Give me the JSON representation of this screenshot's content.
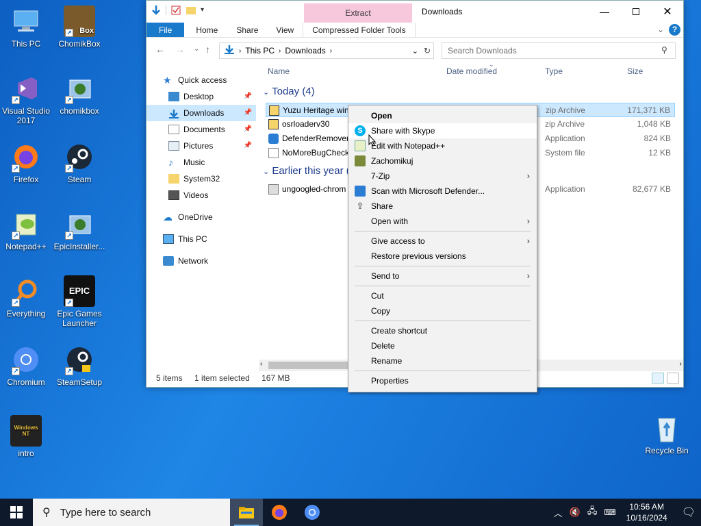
{
  "desktop": {
    "icons": [
      {
        "label": "This PC",
        "icon": "this-pc-icon"
      },
      {
        "label": "ChomikBox",
        "icon": "chomikbox-icon"
      },
      {
        "label": "Visual Studio 2017",
        "icon": "visual-studio-icon"
      },
      {
        "label": "chomikbox",
        "icon": "installer-icon"
      },
      {
        "label": "Firefox",
        "icon": "firefox-icon"
      },
      {
        "label": "Steam",
        "icon": "steam-icon"
      },
      {
        "label": "Notepad++",
        "icon": "notepadpp-icon"
      },
      {
        "label": "EpicInstaller...",
        "icon": "installer-icon"
      },
      {
        "label": "Everything",
        "icon": "everything-icon"
      },
      {
        "label": "Epic Games Launcher",
        "icon": "epic-games-icon"
      },
      {
        "label": "Chromium",
        "icon": "chromium-icon"
      },
      {
        "label": "SteamSetup",
        "icon": "steam-setup-icon"
      },
      {
        "label": "intro",
        "icon": "video-icon"
      },
      {
        "label": "Recycle Bin",
        "icon": "recycle-bin-icon"
      }
    ]
  },
  "explorer": {
    "title": "Downloads",
    "context_tab_header": "Extract",
    "ribbon_tabs": [
      "File",
      "Home",
      "Share",
      "View",
      "Compressed Folder Tools"
    ],
    "address": {
      "parts": [
        "This PC",
        "Downloads"
      ]
    },
    "search_placeholder": "Search Downloads",
    "nav": [
      {
        "label": "Quick access",
        "icon": "star-icon",
        "pinned": false
      },
      {
        "label": "Desktop",
        "icon": "desktop-folder-icon",
        "pinned": true
      },
      {
        "label": "Downloads",
        "icon": "downloads-folder-icon",
        "pinned": true,
        "selected": true
      },
      {
        "label": "Documents",
        "icon": "documents-folder-icon",
        "pinned": true
      },
      {
        "label": "Pictures",
        "icon": "pictures-folder-icon",
        "pinned": true
      },
      {
        "label": "Music",
        "icon": "music-folder-icon",
        "pinned": false
      },
      {
        "label": "System32",
        "icon": "folder-icon",
        "pinned": false
      },
      {
        "label": "Videos",
        "icon": "videos-folder-icon",
        "pinned": false
      },
      {
        "label": "OneDrive",
        "icon": "onedrive-icon",
        "pinned": false
      },
      {
        "label": "This PC",
        "icon": "this-pc-icon",
        "pinned": false
      },
      {
        "label": "Network",
        "icon": "network-icon",
        "pinned": false
      }
    ],
    "columns": [
      "Name",
      "Date modified",
      "Type",
      "Size"
    ],
    "groups": [
      {
        "label": "Today (4)",
        "files": [
          {
            "name": "Yuzu Heritage win",
            "type": "zip Archive",
            "size": "171,371 KB",
            "selected": true
          },
          {
            "name": "osrloaderv30",
            "type": "zip Archive",
            "size": "1,048 KB"
          },
          {
            "name": "DefenderRemover",
            "type": "Application",
            "size": "824 KB"
          },
          {
            "name": "NoMoreBugCheck",
            "type": "System file",
            "size": "12 KB"
          }
        ]
      },
      {
        "label": "Earlier this year (",
        "files": [
          {
            "name": "ungoogled-chrom",
            "type": "Application",
            "size": "82,677 KB"
          }
        ]
      }
    ],
    "status": {
      "items": "5 items",
      "selected": "1 item selected",
      "size": "167 MB"
    }
  },
  "context_menu": {
    "items": [
      {
        "label": "Open",
        "bold": true
      },
      {
        "label": "Share with Skype",
        "icon": "skype-icon",
        "hover": true
      },
      {
        "label": "Edit with Notepad++",
        "icon": "notepadpp-icon"
      },
      {
        "label": "Zachomikuj",
        "icon": "chomik-icon"
      },
      {
        "label": "7-Zip",
        "submenu": true
      },
      {
        "label": "Scan with Microsoft Defender...",
        "icon": "defender-icon"
      },
      {
        "label": "Share",
        "icon": "share-icon"
      },
      {
        "label": "Open with",
        "submenu": true
      },
      {
        "sep": true
      },
      {
        "label": "Give access to",
        "submenu": true
      },
      {
        "label": "Restore previous versions"
      },
      {
        "sep": true
      },
      {
        "label": "Send to",
        "submenu": true
      },
      {
        "sep": true
      },
      {
        "label": "Cut"
      },
      {
        "label": "Copy"
      },
      {
        "sep": true
      },
      {
        "label": "Create shortcut"
      },
      {
        "label": "Delete"
      },
      {
        "label": "Rename"
      },
      {
        "sep": true
      },
      {
        "label": "Properties"
      }
    ]
  },
  "taskbar": {
    "search_placeholder": "Type here to search",
    "apps": [
      "file-explorer-icon",
      "firefox-icon",
      "chromium-icon"
    ],
    "time": "10:56 AM",
    "date": "10/16/2024"
  }
}
